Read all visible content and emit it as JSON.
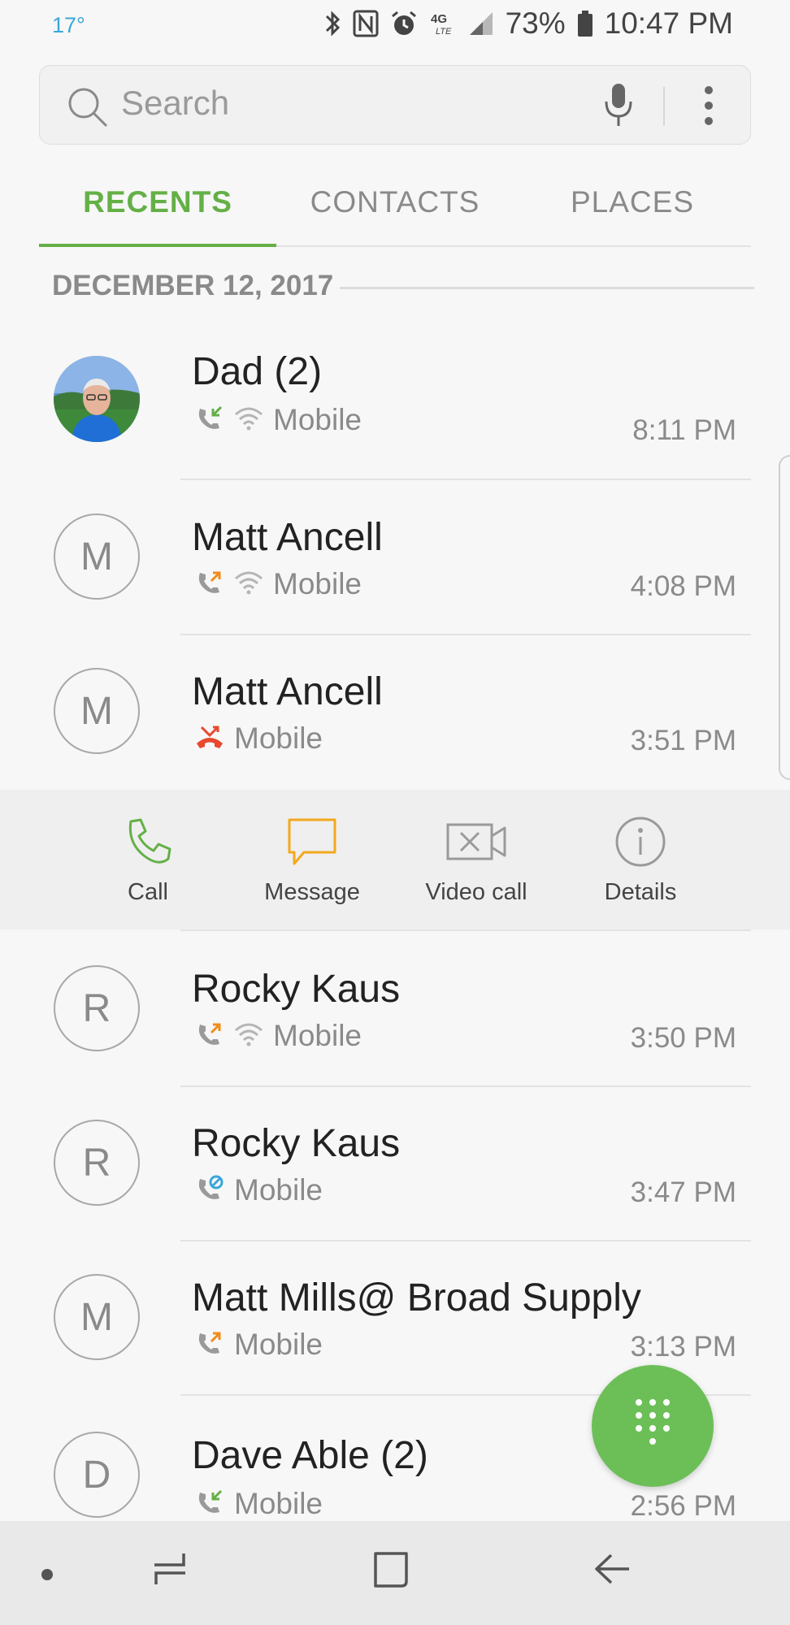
{
  "status_bar": {
    "temperature": "17°",
    "network": "4G LTE",
    "battery_percent": "73%",
    "time": "10:47 PM"
  },
  "search": {
    "placeholder": "Search"
  },
  "tabs": [
    {
      "label": "RECENTS",
      "active": true
    },
    {
      "label": "CONTACTS",
      "active": false
    },
    {
      "label": "PLACES",
      "active": false
    }
  ],
  "date_header": "DECEMBER 12, 2017",
  "calls": [
    {
      "name": "Dad (2)",
      "avatar_letter": "",
      "avatar_type": "photo",
      "call_type": "incoming",
      "wifi": true,
      "label": "Mobile",
      "time": "8:11 PM"
    },
    {
      "name": "Matt Ancell",
      "avatar_letter": "M",
      "avatar_type": "letter",
      "call_type": "outgoing",
      "wifi": true,
      "label": "Mobile",
      "time": "4:08 PM"
    },
    {
      "name": "Matt Ancell",
      "avatar_letter": "M",
      "avatar_type": "letter",
      "call_type": "missed",
      "wifi": false,
      "label": "Mobile",
      "time": "3:51 PM"
    },
    {
      "name": "Rocky Kaus",
      "avatar_letter": "R",
      "avatar_type": "letter",
      "call_type": "outgoing",
      "wifi": true,
      "label": "Mobile",
      "time": "3:50 PM"
    },
    {
      "name": "Rocky Kaus",
      "avatar_letter": "R",
      "avatar_type": "letter",
      "call_type": "rejected",
      "wifi": false,
      "label": "Mobile",
      "time": "3:47 PM"
    },
    {
      "name": "Matt Mills@ Broad Supply",
      "avatar_letter": "M",
      "avatar_type": "letter",
      "call_type": "outgoing",
      "wifi": false,
      "label": "Mobile",
      "time": "3:13 PM"
    },
    {
      "name": "Dave Able (2)",
      "avatar_letter": "D",
      "avatar_type": "letter",
      "call_type": "incoming",
      "wifi": false,
      "label": "Mobile",
      "time": "2:56 PM"
    }
  ],
  "actions": [
    {
      "label": "Call",
      "icon": "phone-icon"
    },
    {
      "label": "Message",
      "icon": "message-icon"
    },
    {
      "label": "Video call",
      "icon": "video-call-icon"
    },
    {
      "label": "Details",
      "icon": "info-icon"
    }
  ],
  "colors": {
    "accent_green": "#64b046",
    "missed_red": "#e8492f",
    "outgoing_orange": "#f08c1a",
    "temp_blue": "#3aa6d8"
  }
}
